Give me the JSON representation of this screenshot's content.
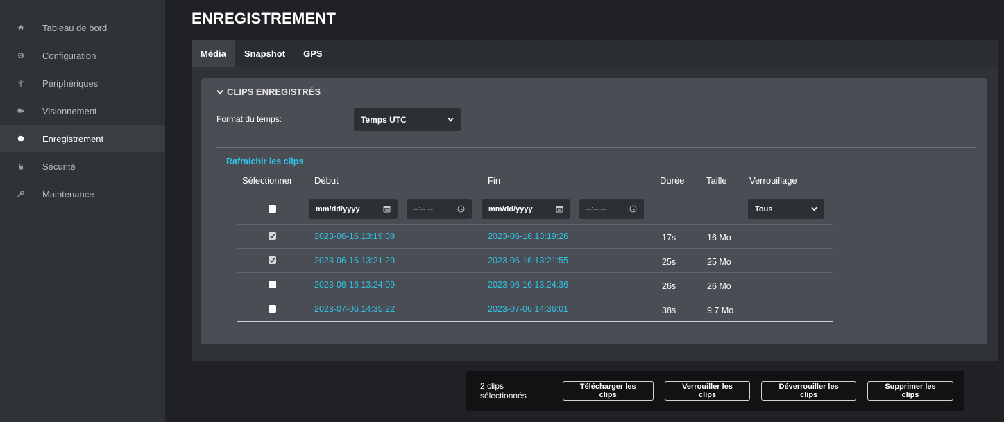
{
  "sidebar": {
    "items": [
      {
        "label": "Tableau de bord",
        "icon": "home-icon",
        "active": false
      },
      {
        "label": "Configuration",
        "icon": "gear-icon",
        "active": false
      },
      {
        "label": "Périphériques",
        "icon": "usb-icon",
        "active": false
      },
      {
        "label": "Visionnement",
        "icon": "camera-icon",
        "active": false
      },
      {
        "label": "Enregistrement",
        "icon": "record-dot-icon",
        "active": true
      },
      {
        "label": "Sécurité",
        "icon": "lock-icon",
        "active": false
      },
      {
        "label": "Maintenance",
        "icon": "wrench-icon",
        "active": false
      }
    ]
  },
  "page": {
    "title": "ENREGISTREMENT"
  },
  "tabs": [
    {
      "label": "Média",
      "active": true
    },
    {
      "label": "Snapshot",
      "active": false
    },
    {
      "label": "GPS",
      "active": false
    }
  ],
  "clips": {
    "section_title": "CLIPS ENREGISTRÉS",
    "time_format_label": "Format du temps:",
    "time_format_value": "Temps UTC",
    "refresh_label": "Rafraichir les clips",
    "columns": {
      "select": "Sélectionner",
      "start": "Début",
      "end": "Fin",
      "duration": "Durée",
      "size": "Taille",
      "lock": "Verrouillage"
    },
    "filters": {
      "start_date_placeholder": "mm/dd/yyyy",
      "start_time_placeholder": "--:-- --",
      "end_date_placeholder": "mm/dd/yyyy",
      "end_time_placeholder": "--:-- --",
      "lock_value": "Tous"
    },
    "rows": [
      {
        "checked": true,
        "start": "2023-06-16 13:19:09",
        "end": "2023-06-16 13:19:26",
        "duration": "17s",
        "size": "16 Mo"
      },
      {
        "checked": true,
        "start": "2023-06-16 13:21:29",
        "end": "2023-06-16 13:21:55",
        "duration": "25s",
        "size": "25 Mo"
      },
      {
        "checked": false,
        "start": "2023-06-16 13:24:09",
        "end": "2023-06-16 13:24:36",
        "duration": "26s",
        "size": "26 Mo"
      },
      {
        "checked": false,
        "start": "2023-07-06 14:35:22",
        "end": "2023-07-06 14:36:01",
        "duration": "38s",
        "size": "9.7 Mo"
      }
    ]
  },
  "actions": {
    "selected_count": "2 clips sélectionnés",
    "download": "Télécharger les clips",
    "lock": "Verrouiller les clips",
    "unlock": "Déverrouiller les clips",
    "delete": "Supprimer les clips"
  },
  "colors": {
    "accent_link": "#2ec4ea",
    "background": "#1f2124",
    "card": "#4a4d53"
  }
}
